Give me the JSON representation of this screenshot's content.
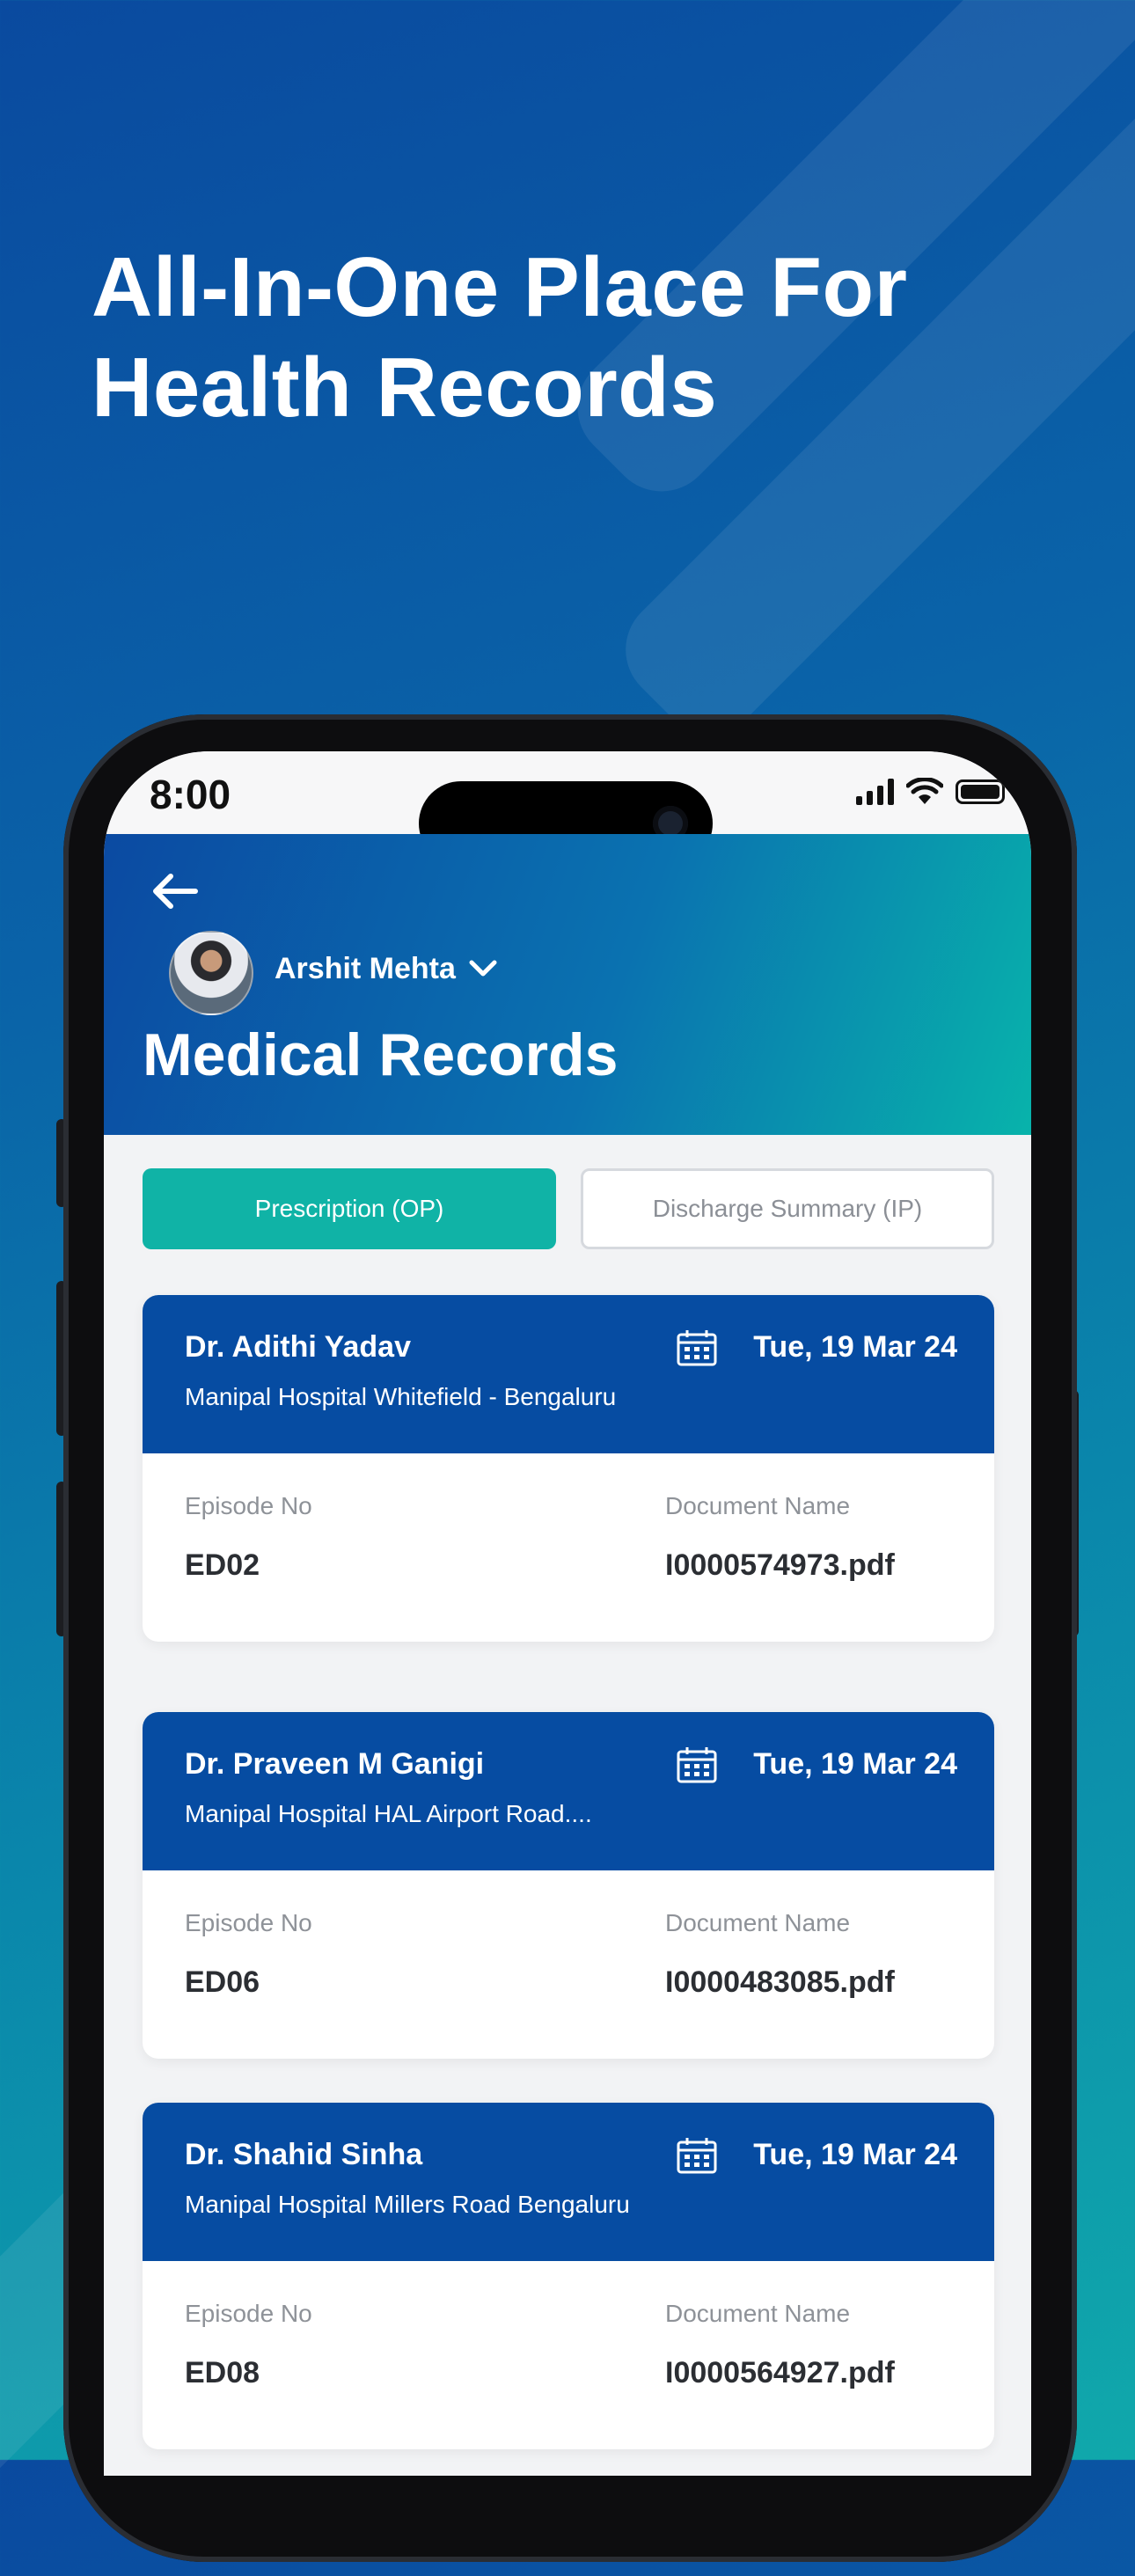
{
  "headline": "All-In-One Place For Health Records",
  "status_bar": {
    "time": "8:00",
    "icons": [
      "signal-icon",
      "wifi-icon",
      "battery-icon"
    ]
  },
  "header": {
    "user_name": "Arshit Mehta",
    "title": "Medical Records"
  },
  "tabs": [
    {
      "label": "Prescription (OP)",
      "active": true
    },
    {
      "label": "Discharge Summary (IP)",
      "active": false
    }
  ],
  "records": [
    {
      "doctor": "Dr. Adithi Yadav",
      "hospital": "Manipal Hospital Whitefield - Bengaluru",
      "date": "Tue, 19 Mar 24",
      "episode_label": "Episode No",
      "episode": "ED02",
      "document_label": "Document Name",
      "document": "I0000574973.pdf"
    },
    {
      "doctor": "Dr. Praveen M Ganigi",
      "hospital": "Manipal Hospital HAL Airport Road....",
      "date": "Tue, 19 Mar 24",
      "episode_label": "Episode No",
      "episode": "ED06",
      "document_label": "Document Name",
      "document": "I0000483085.pdf"
    },
    {
      "doctor": "Dr. Shahid Sinha",
      "hospital": "Manipal Hospital Millers Road Bengaluru",
      "date": "Tue, 19 Mar 24",
      "episode_label": "Episode No",
      "episode": "ED08",
      "document_label": "Document Name",
      "document": "I0000564927.pdf"
    }
  ],
  "colors": {
    "header_start": "#0b4aa2",
    "header_end": "#08b3ab",
    "active_tab": "#10b3a6",
    "card_header": "#064ca2"
  }
}
